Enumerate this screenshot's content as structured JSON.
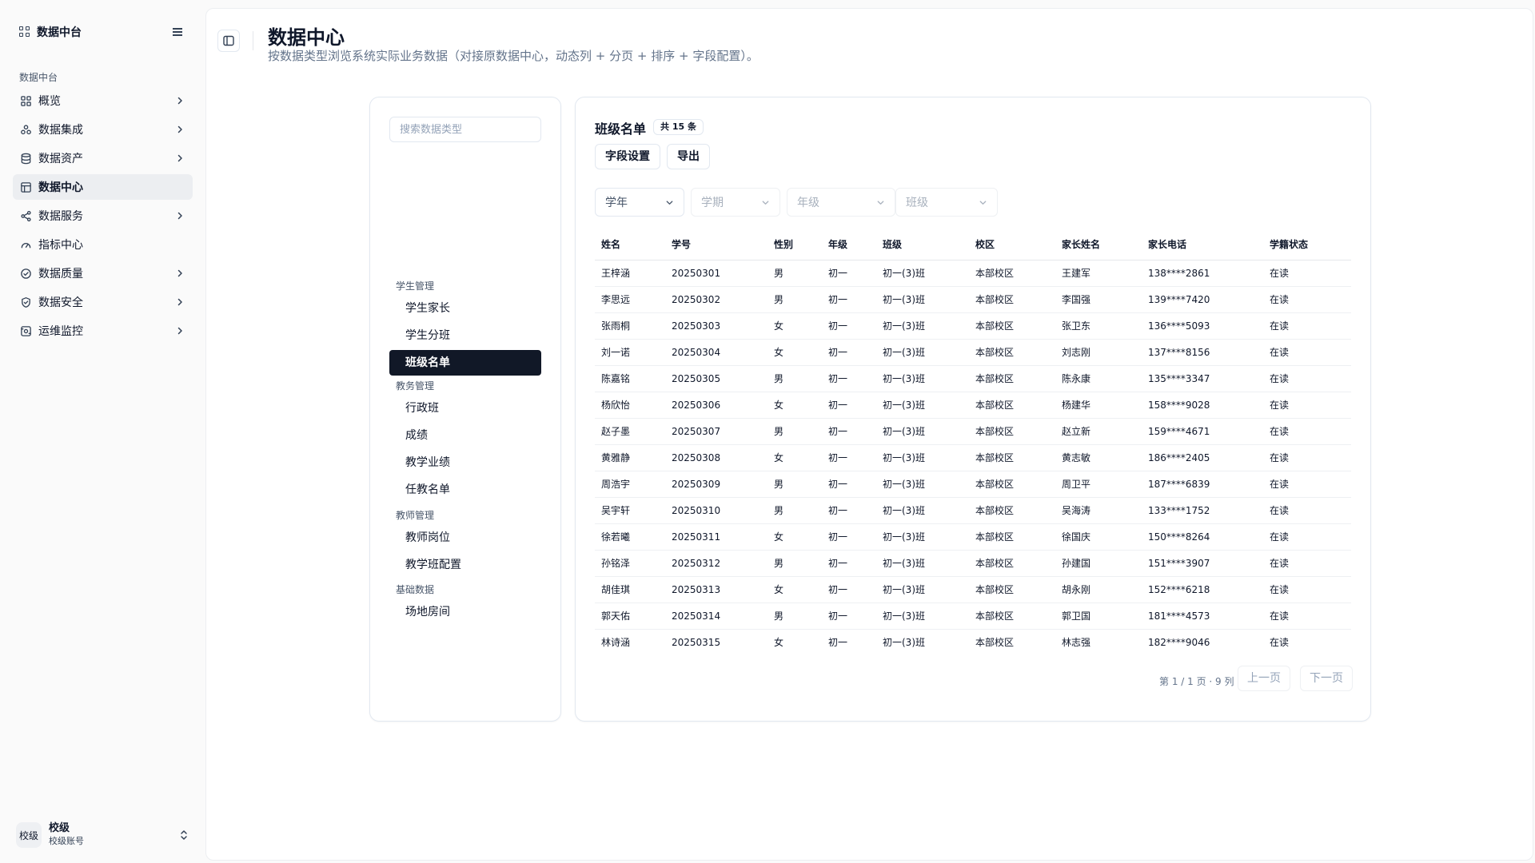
{
  "sidebar": {
    "brand": "数据中台",
    "group_label": "数据中台",
    "items": [
      {
        "label": "概览",
        "icon": "dashboard-icon"
      },
      {
        "label": "数据集成",
        "icon": "integration-icon"
      },
      {
        "label": "数据资产",
        "icon": "database-icon"
      },
      {
        "label": "数据中心",
        "icon": "table-icon",
        "active": true
      },
      {
        "label": "数据服务",
        "icon": "share-icon"
      },
      {
        "label": "指标中心",
        "icon": "gauge-icon"
      },
      {
        "label": "数据质量",
        "icon": "check-circle-icon"
      },
      {
        "label": "数据安全",
        "icon": "shield-check-icon"
      },
      {
        "label": "运维监控",
        "icon": "monitor-icon"
      }
    ],
    "user": {
      "avatar": "校级",
      "name": "校级",
      "account": "校级账号"
    }
  },
  "header": {
    "title": "数据中心",
    "description": "按数据类型浏览系统实际业务数据（对接原数据中心，动态列 + 分页 + 排序 + 字段配置）。"
  },
  "types_panel": {
    "search_placeholder": "搜索数据类型",
    "groups": [
      {
        "label": "学生管理",
        "items": [
          "学生家长",
          "学生分班",
          "班级名单"
        ]
      },
      {
        "label": "教务管理",
        "items": [
          "行政班",
          "成绩",
          "教学业绩",
          "任教名单"
        ]
      },
      {
        "label": "教师管理",
        "items": [
          "教师岗位",
          "教学班配置"
        ]
      },
      {
        "label": "基础数据",
        "items": [
          "场地房间"
        ]
      }
    ],
    "active_item": "班级名单"
  },
  "table_panel": {
    "title": "班级名单",
    "count_badge": "共 15 条",
    "field_settings_label": "字段设置",
    "export_label": "导出",
    "filters": [
      {
        "label": "学年",
        "enabled": true
      },
      {
        "label": "学期",
        "enabled": false
      },
      {
        "label": "年级",
        "enabled": false
      },
      {
        "label": "班级",
        "enabled": false
      }
    ],
    "columns": [
      "姓名",
      "学号",
      "性别",
      "年级",
      "班级",
      "校区",
      "家长姓名",
      "家长电话",
      "学籍状态"
    ],
    "rows": [
      [
        "王梓涵",
        "20250301",
        "男",
        "初一",
        "初一(3)班",
        "本部校区",
        "王建军",
        "138****2861",
        "在读"
      ],
      [
        "李思远",
        "20250302",
        "男",
        "初一",
        "初一(3)班",
        "本部校区",
        "李国强",
        "139****7420",
        "在读"
      ],
      [
        "张雨桐",
        "20250303",
        "女",
        "初一",
        "初一(3)班",
        "本部校区",
        "张卫东",
        "136****5093",
        "在读"
      ],
      [
        "刘一诺",
        "20250304",
        "女",
        "初一",
        "初一(3)班",
        "本部校区",
        "刘志刚",
        "137****8156",
        "在读"
      ],
      [
        "陈嘉铭",
        "20250305",
        "男",
        "初一",
        "初一(3)班",
        "本部校区",
        "陈永康",
        "135****3347",
        "在读"
      ],
      [
        "杨欣怡",
        "20250306",
        "女",
        "初一",
        "初一(3)班",
        "本部校区",
        "杨建华",
        "158****9028",
        "在读"
      ],
      [
        "赵子墨",
        "20250307",
        "男",
        "初一",
        "初一(3)班",
        "本部校区",
        "赵立新",
        "159****4671",
        "在读"
      ],
      [
        "黄雅静",
        "20250308",
        "女",
        "初一",
        "初一(3)班",
        "本部校区",
        "黄志敏",
        "186****2405",
        "在读"
      ],
      [
        "周浩宇",
        "20250309",
        "男",
        "初一",
        "初一(3)班",
        "本部校区",
        "周卫平",
        "187****6839",
        "在读"
      ],
      [
        "吴宇轩",
        "20250310",
        "男",
        "初一",
        "初一(3)班",
        "本部校区",
        "吴海涛",
        "133****1752",
        "在读"
      ],
      [
        "徐若曦",
        "20250311",
        "女",
        "初一",
        "初一(3)班",
        "本部校区",
        "徐国庆",
        "150****8264",
        "在读"
      ],
      [
        "孙铭泽",
        "20250312",
        "男",
        "初一",
        "初一(3)班",
        "本部校区",
        "孙建国",
        "151****3907",
        "在读"
      ],
      [
        "胡佳琪",
        "20250313",
        "女",
        "初一",
        "初一(3)班",
        "本部校区",
        "胡永刚",
        "152****6218",
        "在读"
      ],
      [
        "郭天佑",
        "20250314",
        "男",
        "初一",
        "初一(3)班",
        "本部校区",
        "郭卫国",
        "181****4573",
        "在读"
      ],
      [
        "林诗涵",
        "20250315",
        "女",
        "初一",
        "初一(3)班",
        "本部校区",
        "林志强",
        "182****9046",
        "在读"
      ]
    ],
    "pager_info": "第 1 / 1 页 · 9 列",
    "prev_label": "上一页",
    "next_label": "下一页"
  }
}
